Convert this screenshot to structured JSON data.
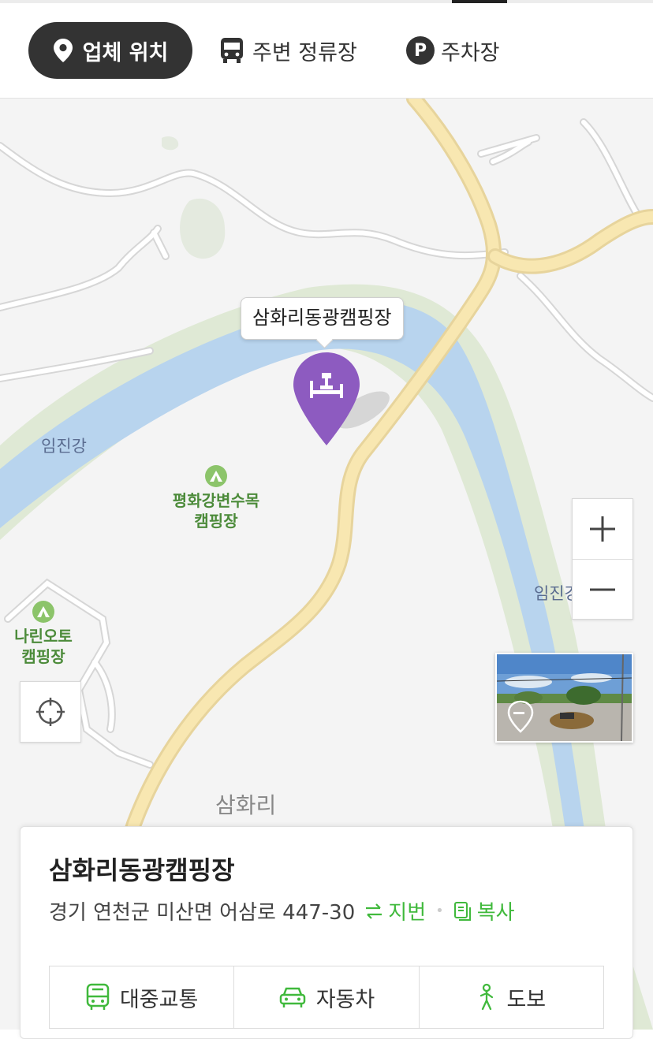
{
  "tabs": [
    {
      "label": "업체 위치",
      "icon": "location-pin-icon",
      "active": true
    },
    {
      "label": "주변 정류장",
      "icon": "bus-icon",
      "active": false
    },
    {
      "label": "주차장",
      "icon": "parking-icon",
      "icon_text": "P",
      "active": false
    }
  ],
  "map": {
    "callout_label": "삼화리동광캠핑장",
    "pin_icon": "bed-icon",
    "pin_color": "#8d5bc0",
    "labels": {
      "river_left": "임진강",
      "river_right": "임진강",
      "village": "삼화리"
    },
    "pois": [
      {
        "name": "평화강변수목\n캠핑장",
        "line1": "평화강변수목",
        "line2": "캠핑장",
        "icon": "tent-icon"
      },
      {
        "name": "나린오토\n캠핑장",
        "line1": "나린오토",
        "line2": "캠핑장",
        "icon": "tent-icon"
      }
    ],
    "controls": {
      "zoom_in": "+",
      "zoom_out": "−",
      "locate_icon": "crosshair-icon",
      "streetview_icon": "street-view-icon"
    }
  },
  "place": {
    "title": "삼화리동광캠핑장",
    "address": "경기 연천군 미산면 어삼로 447-30",
    "toggle_label": "지번",
    "copy_label": "복사",
    "accent_color": "#40b93c"
  },
  "directions": [
    {
      "label": "대중교통",
      "icon": "bus-icon"
    },
    {
      "label": "자동차",
      "icon": "car-icon"
    },
    {
      "label": "도보",
      "icon": "walk-icon"
    }
  ]
}
